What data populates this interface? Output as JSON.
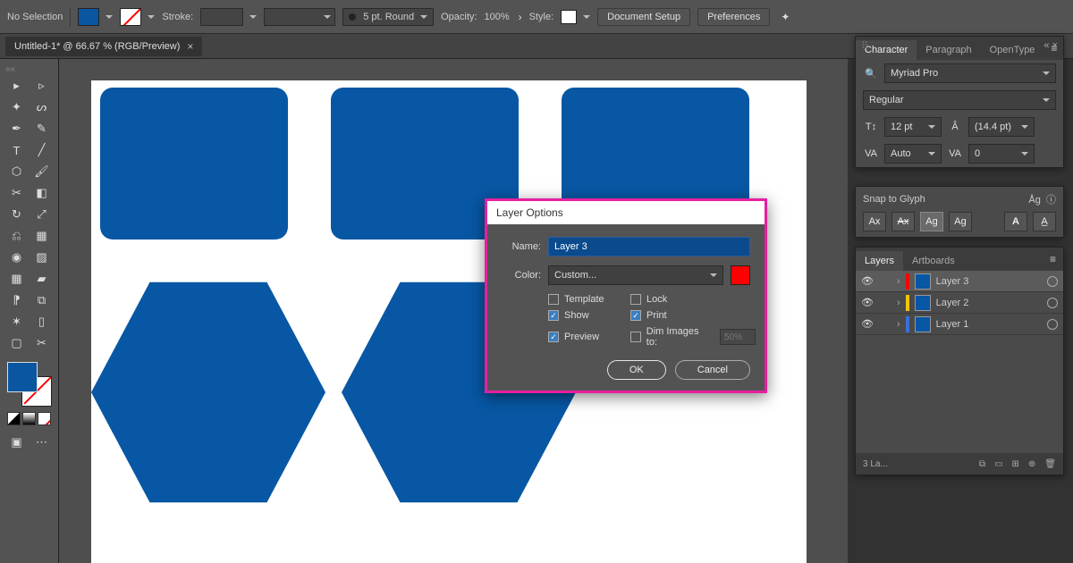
{
  "topbar": {
    "selection": "No Selection",
    "stroke_label": "Stroke:",
    "brush_label": "5 pt. Round",
    "opacity_label": "Opacity:",
    "opacity_value": "100%",
    "style_label": "Style:",
    "doc_setup": "Document Setup",
    "prefs": "Preferences"
  },
  "doctab": {
    "title": "Untitled-1* @ 66.67 % (RGB/Preview)"
  },
  "charPanel": {
    "tabs": [
      "Character",
      "Paragraph",
      "OpenType"
    ],
    "font": "Myriad Pro",
    "style": "Regular",
    "size": "12 pt",
    "leading": "(14.4 pt)",
    "kerning": "Auto",
    "tracking": "0",
    "snap_label": "Snap to Glyph"
  },
  "layersPanel": {
    "tabs": [
      "Layers",
      "Artboards"
    ],
    "layers": [
      {
        "name": "Layer 3",
        "color": "#ff0000",
        "sel": true
      },
      {
        "name": "Layer 2",
        "color": "#f5c400",
        "sel": false
      },
      {
        "name": "Layer 1",
        "color": "#3a6fd8",
        "sel": false
      }
    ],
    "footer": "3 La..."
  },
  "dialog": {
    "title": "Layer Options",
    "name_label": "Name:",
    "name_value": "Layer 3",
    "color_label": "Color:",
    "color_value": "Custom...",
    "template": "Template",
    "lock": "Lock",
    "show": "Show",
    "print": "Print",
    "preview": "Preview",
    "dim": "Dim Images to:",
    "dim_value": "50%",
    "ok": "OK",
    "cancel": "Cancel"
  }
}
